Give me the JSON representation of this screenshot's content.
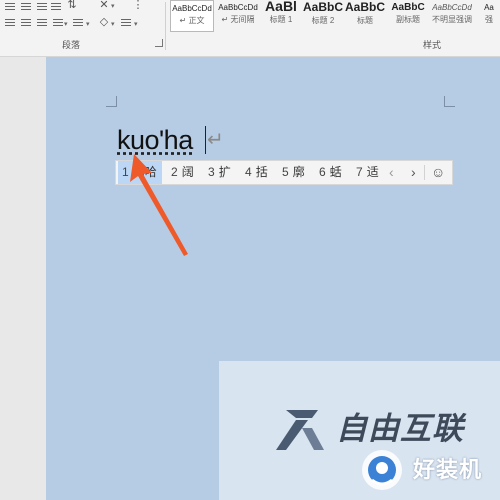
{
  "ribbon": {
    "paragraph_group_label": "段落",
    "styles_group_label": "样式",
    "styles": [
      {
        "preview": "AaBbCcDd",
        "name": "正文",
        "selected": true
      },
      {
        "preview": "AaBbCcDd",
        "name": "无间隔",
        "selected": false
      },
      {
        "preview": "AaBl",
        "name": "标题 1",
        "selected": false
      },
      {
        "preview": "AaBbC",
        "name": "标题 2",
        "selected": false
      },
      {
        "preview": "AaBbC",
        "name": "标题",
        "selected": false
      },
      {
        "preview": "AaBbC",
        "name": "副标题",
        "selected": false
      },
      {
        "preview": "AaBbCcDd",
        "name": "不明显强调",
        "selected": false
      },
      {
        "preview": "Aa",
        "name": "强",
        "selected": false
      }
    ]
  },
  "document": {
    "typed_text": "kuo'ha",
    "paragraph_mark": "↵"
  },
  "ime": {
    "candidates": [
      {
        "num": "1",
        "text": "阔哈",
        "selected": true
      },
      {
        "num": "2",
        "text": "阔",
        "selected": false
      },
      {
        "num": "3",
        "text": "扩",
        "selected": false
      },
      {
        "num": "4",
        "text": "括",
        "selected": false
      },
      {
        "num": "5",
        "text": "廓",
        "selected": false
      },
      {
        "num": "6",
        "text": "蛞",
        "selected": false
      },
      {
        "num": "7",
        "text": "适",
        "selected": false
      }
    ],
    "prev": "‹",
    "next": "›",
    "emoji": "☺"
  },
  "watermark": {
    "brand": "自由互联",
    "badge_text": "好装机"
  },
  "colors": {
    "page": "#b6cbe4",
    "arrow": "#ee5a2a",
    "candidate_highlight": "#bcd6f6"
  }
}
